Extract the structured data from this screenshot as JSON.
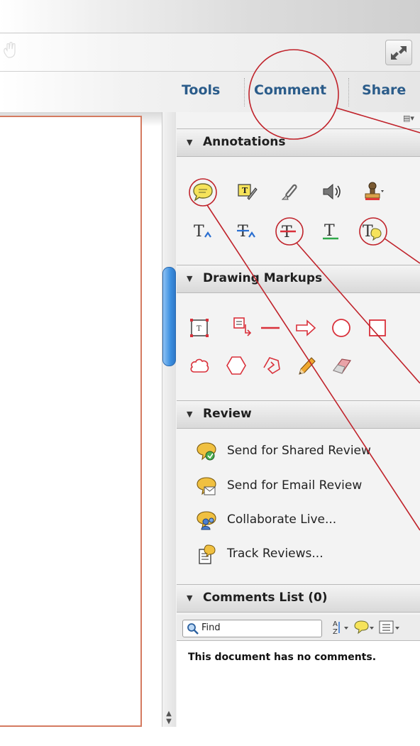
{
  "tabs": {
    "tools": "Tools",
    "comment": "Comment",
    "share": "Share"
  },
  "panel": {
    "annotations_title": "Annotations",
    "drawing_title": "Drawing Markups",
    "review_title": "Review",
    "review_items": [
      {
        "label": "Send for Shared Review",
        "icon": "shared-review-icon"
      },
      {
        "label": "Send for Email Review",
        "icon": "email-review-icon"
      },
      {
        "label": "Collaborate Live...",
        "icon": "collaborate-live-icon"
      },
      {
        "label": "Track Reviews...",
        "icon": "track-reviews-icon"
      }
    ],
    "comments_title": "Comments List (0)",
    "find_label": "Find",
    "no_comments": "This document has no comments."
  },
  "colors": {
    "tab_text": "#2b5c8a",
    "callout_red": "#c0232b",
    "drawing_red": "#d9303a",
    "scroll_blue": "#3c8fe0"
  }
}
